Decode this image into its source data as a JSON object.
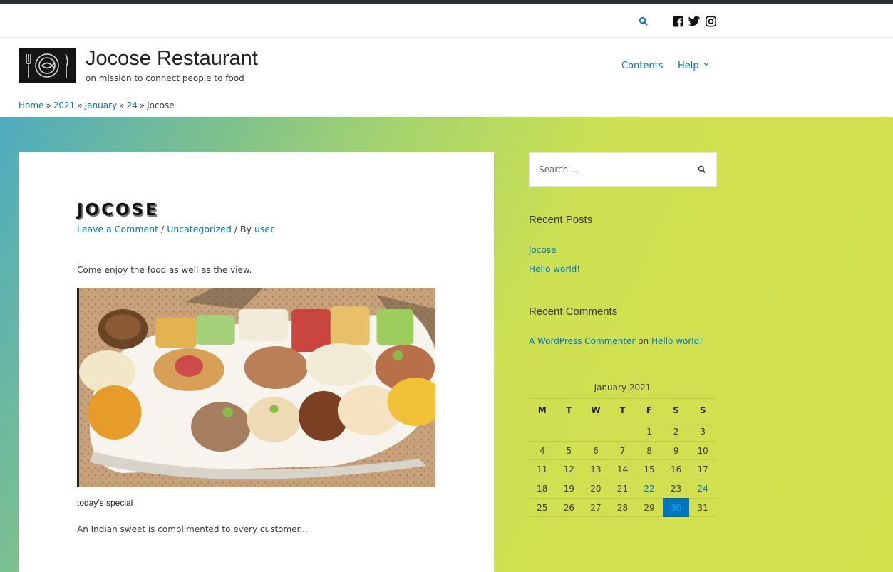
{
  "site": {
    "title": "Jocose Restaurant",
    "tagline": "on mission to connect people to food"
  },
  "nav": {
    "items": [
      {
        "label": "Contents"
      },
      {
        "label": "Help"
      }
    ]
  },
  "breadcrumb": {
    "items": [
      "Home",
      "2021",
      "January",
      "24"
    ],
    "current": "Jocose",
    "separator": "»"
  },
  "post": {
    "title": "JOCOSE",
    "meta": {
      "comment_link": "Leave a Comment",
      "category": "Uncategorized",
      "by_prefix": "By",
      "author": "user",
      "separator": "/"
    },
    "intro": "Come enjoy the food as well as the view.",
    "image_caption": "today's special",
    "body": "An Indian sweet is complimented to every customer..."
  },
  "sidebar": {
    "search_placeholder": "Search ...",
    "recent_posts_title": "Recent Posts",
    "recent_posts": [
      "Jocose",
      "Hello world!"
    ],
    "recent_comments_title": "Recent Comments",
    "recent_comment": {
      "author": "A WordPress Commenter",
      "on": "on",
      "post": "Hello world!"
    },
    "calendar": {
      "caption": "January 2021",
      "weekdays": [
        "M",
        "T",
        "W",
        "T",
        "F",
        "S",
        "S"
      ],
      "weeks": [
        [
          "",
          "",
          "",
          "",
          "1",
          "2",
          "3"
        ],
        [
          "4",
          "5",
          "6",
          "7",
          "8",
          "9",
          "10"
        ],
        [
          "11",
          "12",
          "13",
          "14",
          "15",
          "16",
          "17"
        ],
        [
          "18",
          "19",
          "20",
          "21",
          "22",
          "23",
          "24"
        ],
        [
          "25",
          "26",
          "27",
          "28",
          "29",
          "30",
          "31"
        ]
      ],
      "linked_days": [
        "22",
        "24"
      ],
      "today": "30"
    }
  },
  "colors": {
    "link": "#0274be",
    "topbar": "#2a2d31",
    "gradient_start": "#4eabbf",
    "gradient_end": "#d6e14e"
  }
}
